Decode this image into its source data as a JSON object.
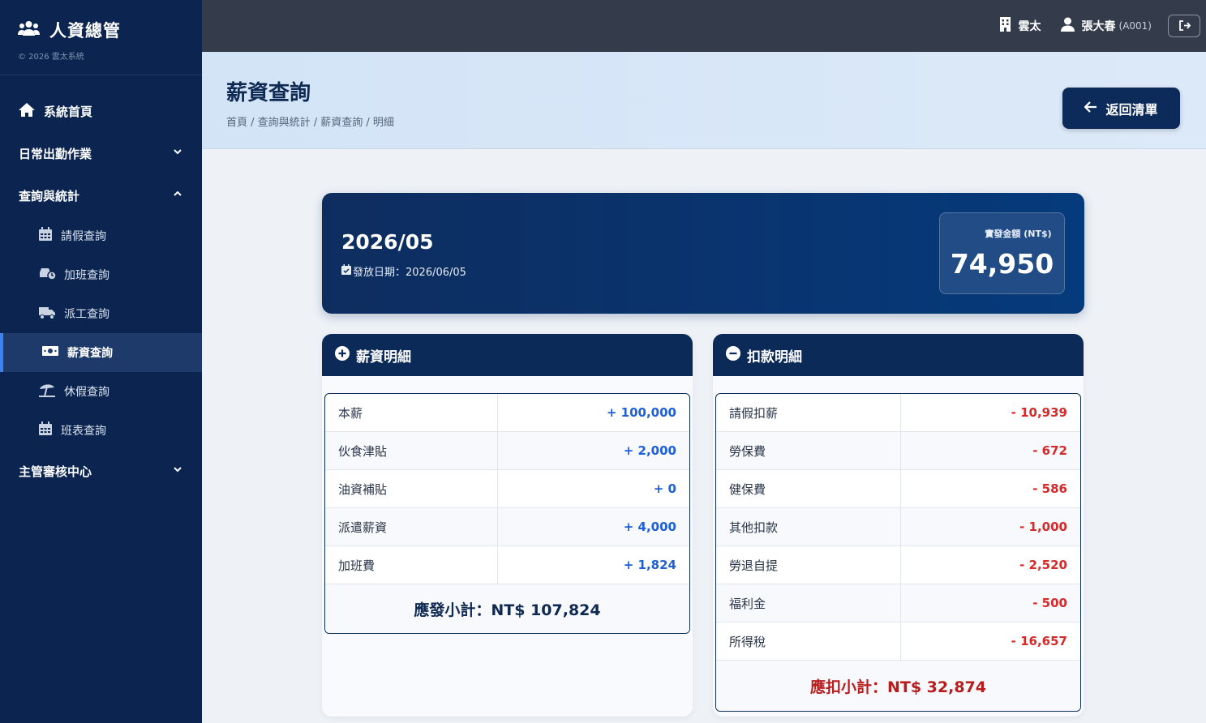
{
  "sidebar": {
    "brand_title": "人資總管",
    "brand_copy": "© 2026 雲太系統",
    "home": "系統首頁",
    "daily": "日常出勤作業",
    "query": "查詢與統計",
    "sub": [
      "請假查詢",
      "加班查詢",
      "派工查詢",
      "薪資查詢",
      "休假查詢",
      "班表查詢"
    ],
    "manager": "主管審核中心"
  },
  "topbar": {
    "company": "雲太",
    "user_name": "張大春",
    "user_id": "(A001)"
  },
  "header": {
    "title": "薪資查詢",
    "breadcrumb": "首頁 / 查詢與統計 / 薪資查詢 / 明細",
    "back_label": "返回清單"
  },
  "summary": {
    "period": "2026/05",
    "pay_date": "發放日期：2026/06/05",
    "net_label": "實發金額 (NT$)",
    "net_value": "74,950"
  },
  "earnings": {
    "title": "薪資明細",
    "rows": [
      {
        "name": "本薪",
        "value": "+ 100,000"
      },
      {
        "name": "伙食津貼",
        "value": "+ 2,000"
      },
      {
        "name": "油資補貼",
        "value": "+ 0"
      },
      {
        "name": "派遣薪資",
        "value": "+ 4,000"
      },
      {
        "name": "加班費",
        "value": "+ 1,824"
      }
    ],
    "subtotal": "應發小計：NT$ 107,824"
  },
  "deductions": {
    "title": "扣款明細",
    "rows": [
      {
        "name": "請假扣薪",
        "value": "- 10,939"
      },
      {
        "name": "勞保費",
        "value": "- 672"
      },
      {
        "name": "健保費",
        "value": "- 586"
      },
      {
        "name": "其他扣款",
        "value": "- 1,000"
      },
      {
        "name": "勞退自提",
        "value": "- 2,520"
      },
      {
        "name": "福利金",
        "value": "- 500"
      },
      {
        "name": "所得稅",
        "value": "- 16,657"
      }
    ],
    "subtotal": "應扣小計：NT$ 32,874"
  },
  "colors": {
    "sidebar_bg": "#0b2550",
    "topbar_bg": "#343c4b",
    "accent_blue": "#1f5fd8",
    "negative_red": "#d62a2a"
  },
  "icons": [
    "users-icon",
    "home-icon",
    "calendar-icon",
    "car-clock-icon",
    "truck-icon",
    "money-icon",
    "beach-umbrella-icon",
    "building-icon",
    "user-icon",
    "logout-icon",
    "arrow-left-icon",
    "plus-circle-icon",
    "minus-circle-icon"
  ]
}
